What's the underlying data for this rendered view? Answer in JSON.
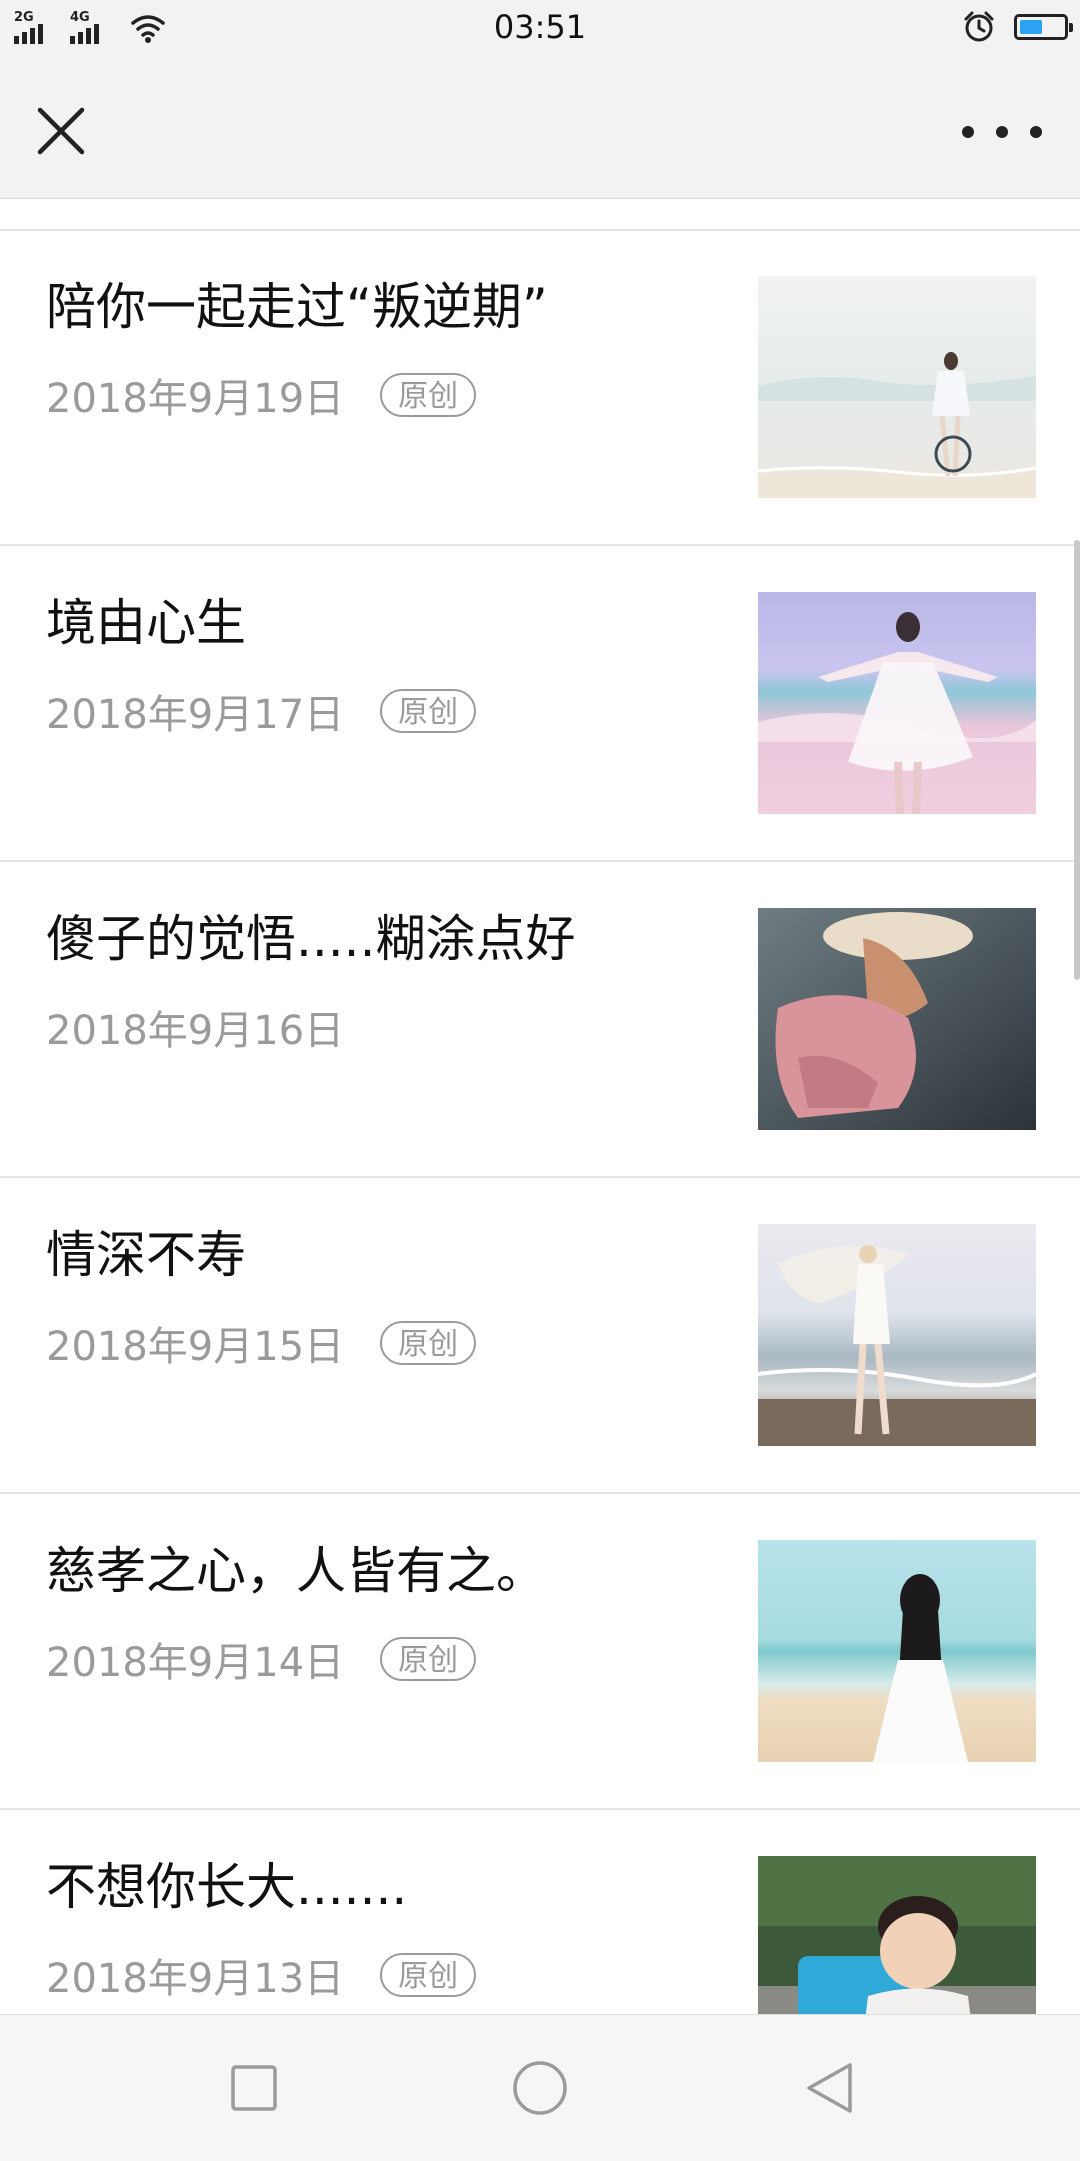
{
  "status_bar": {
    "network_1": "2G",
    "network_2": "4G",
    "time": "03:51",
    "battery_level": 0.5,
    "battery_color": "#2aa3f3"
  },
  "header": {
    "close_icon": "close-icon",
    "more_icon": "more-icon"
  },
  "articles": [
    {
      "title": "陪你一起走过“叛逆期”",
      "date": "2018年9月19日",
      "tag": "原创",
      "thumb": "woman-on-beach-with-hat"
    },
    {
      "title": "境由心生",
      "date": "2018年9月17日",
      "tag": "原创",
      "thumb": "woman-white-dress-beach"
    },
    {
      "title": "傻子的觉悟.....糊涂点好",
      "date": "2018年9月16日",
      "tag": "",
      "thumb": "woman-pink-dress-hat"
    },
    {
      "title": "情深不寿",
      "date": "2018年9月15日",
      "tag": "原创",
      "thumb": "woman-scarf-shore"
    },
    {
      "title": "慈孝之心，人皆有之。",
      "date": "2018年9月14日",
      "tag": "原创",
      "thumb": "woman-black-hair-beach"
    },
    {
      "title": "不想你长大.......",
      "date": "2018年9月13日",
      "tag": "原创",
      "thumb": "little-girl"
    }
  ],
  "nav": {
    "recent_icon": "square-icon",
    "home_icon": "circle-icon",
    "back_icon": "triangle-back-icon"
  }
}
